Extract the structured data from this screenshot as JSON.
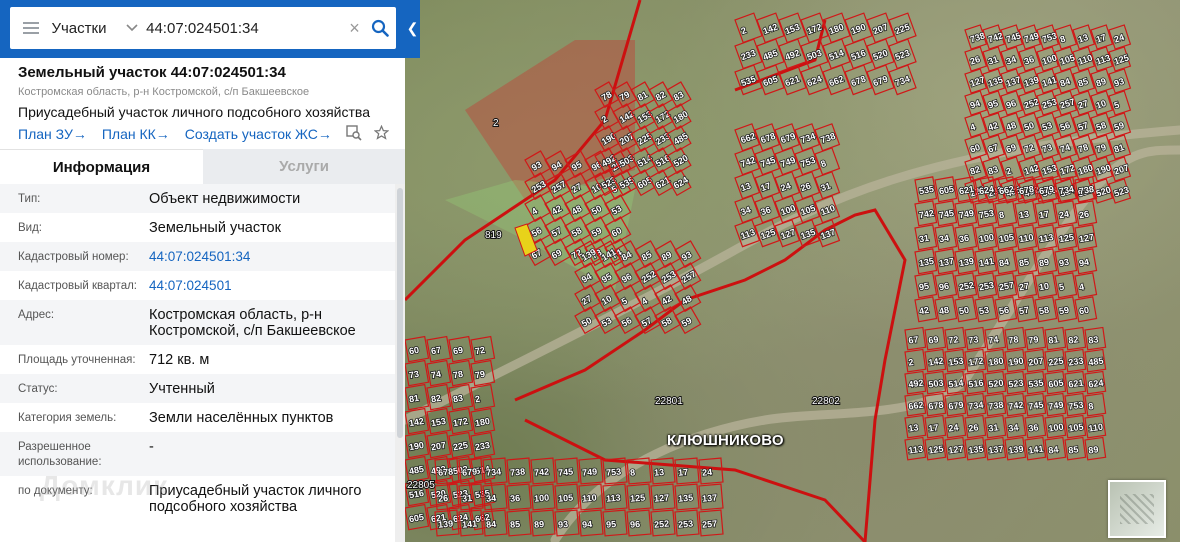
{
  "search": {
    "layer_label": "Участки",
    "query": "44:07:024501:34"
  },
  "parcel": {
    "title": "Земельный участок 44:07:024501:34",
    "address_short": "Костромская область, р-н Костромской, с/п Бакшеевское",
    "purpose": "Приусадебный участок личного подсобного хозяйства"
  },
  "links": {
    "plan_zu": "План ЗУ",
    "plan_kk": "План КК",
    "create_zhs": "Создать участок ЖС",
    "arrow": "→"
  },
  "tabs": [
    {
      "label": "Информация",
      "active": true
    },
    {
      "label": "Услуги",
      "active": false
    }
  ],
  "info_rows": [
    {
      "key": "Тип:",
      "value": "Объект недвижимости"
    },
    {
      "key": "Вид:",
      "value": "Земельный участок"
    },
    {
      "key": "Кадастровый номер:",
      "value": "44:07:024501:34",
      "link": true
    },
    {
      "key": "Кадастровый квартал:",
      "value": "44:07:024501",
      "link": true
    },
    {
      "key": "Адрес:",
      "value": "Костромская область, р-н Костромской, с/п Бакшеевское"
    },
    {
      "key": "Площадь уточненная:",
      "value": "712 кв. м"
    },
    {
      "key": "Статус:",
      "value": "Учтенный"
    },
    {
      "key": "Категория земель:",
      "value": "Земли населённых пунктов"
    },
    {
      "key": "Разрешенное использование:",
      "value": "-"
    },
    {
      "key": "по документу:",
      "value": "Приусадебный участок личного подсобного хозяйства"
    }
  ],
  "watermark": "Домклик",
  "map": {
    "village_label": "КЛЮШНИКОВО",
    "quarter_labels": [
      "22801",
      "22802",
      "22805",
      "819",
      "2"
    ],
    "parcel_numbers": [
      "2",
      "142",
      "153",
      "172",
      "180",
      "190",
      "207",
      "225",
      "233",
      "485",
      "492",
      "503",
      "514",
      "516",
      "520",
      "523",
      "535",
      "605",
      "621",
      "624",
      "662",
      "678",
      "679",
      "734",
      "738",
      "742",
      "745",
      "749",
      "753",
      "8",
      "13",
      "17",
      "24",
      "26",
      "31",
      "34",
      "36",
      "100",
      "105",
      "110",
      "113",
      "125",
      "127",
      "135",
      "137",
      "139",
      "141",
      "84",
      "85",
      "89",
      "93",
      "94",
      "95",
      "96",
      "252",
      "253",
      "257",
      "27",
      "10",
      "5",
      "4",
      "42",
      "48",
      "50",
      "53",
      "56",
      "57",
      "58",
      "59",
      "60",
      "67",
      "69",
      "72",
      "73",
      "74",
      "78",
      "79",
      "81",
      "82",
      "83"
    ],
    "accent_color": "#d01818",
    "selected_color": "#e8d21a"
  }
}
